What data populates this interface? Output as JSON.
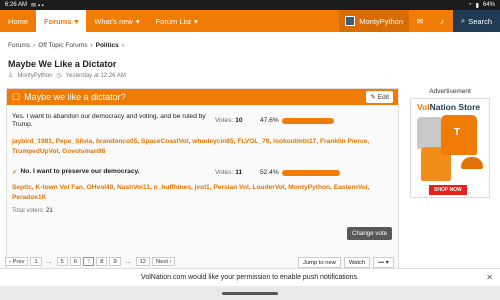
{
  "status_bar": {
    "time": "6:26 AM",
    "battery": "64%"
  },
  "nav": {
    "home": "Home",
    "forums": "Forums",
    "whats_new": "What's new",
    "forum_list": "Forum List",
    "user": "MontyPython",
    "search": "Search"
  },
  "breadcrumb": {
    "forums": "Forums",
    "offtopic": "Off Topic Forums",
    "politics": "Politics"
  },
  "thread": {
    "title": "Maybe We Like a Dictator",
    "author": "MontyPython",
    "time": "Yesterday at 12:26 AM"
  },
  "poll": {
    "title": "Maybe we like a dictator?",
    "edit": "Edit",
    "options": [
      {
        "text": "Yes. I want to abandon our democracy and voting, and be ruled by Trump.",
        "votes_label": "Votes:",
        "votes": "10",
        "percent": "47.6%",
        "fraction": 0.476,
        "voters": [
          "jaybird_1981",
          "Pepe_Silvia",
          "brandonco05",
          "SpaceCoastVol",
          "whodeycin85",
          "FLVOL_79",
          "lookoutmtn17",
          "Franklin Pierce",
          "TrumpedUpVol",
          "Govolsman98"
        ]
      },
      {
        "text": "No. I want to preserve our democracy.",
        "votes_label": "Votes:",
        "votes": "11",
        "percent": "52.4%",
        "fraction": 0.524,
        "voters": [
          "Septic",
          "K-town Vol Fan",
          "OHvol40",
          "NashVol11",
          "n_huffhines",
          "jvol1",
          "Persian Vol",
          "LouderVol",
          "MontyPython",
          "EasternVol",
          "Peradox1K"
        ]
      }
    ],
    "total_label": "Total voters:",
    "total": "21",
    "change_vote": "Change vote"
  },
  "ad": {
    "label": "Advertisement",
    "title_a": "Vol",
    "title_b": "Nation Store",
    "shop": "SHOP NOW"
  },
  "pager": {
    "prev": "Prev",
    "pages": [
      "1",
      "...",
      "5",
      "6",
      "7",
      "8",
      "9",
      "...",
      "12"
    ],
    "next": "Next"
  },
  "thread_actions": {
    "jump": "Jump to new",
    "watch": "Watch",
    "more": "•••"
  },
  "push_bar": {
    "message": "VolNation.com would like your permission to enable push notifications."
  },
  "colors": {
    "accent": "#f07b05",
    "nav_dark": "#1e3a54"
  }
}
